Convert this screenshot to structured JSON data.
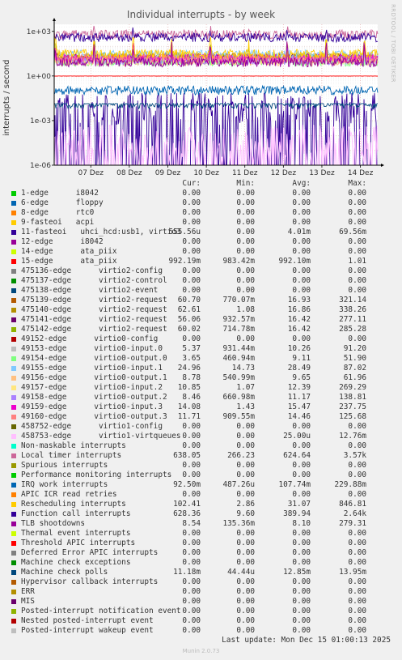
{
  "chart_data": {
    "type": "line",
    "title": "Individual interrupts - by week",
    "ylabel": "interrupts / second",
    "yscale": "log",
    "ylim": [
      1e-06,
      3000
    ],
    "yticks": [
      {
        "value": 1000,
        "label": "1e+03"
      },
      {
        "value": 1,
        "label": "1e+00"
      },
      {
        "value": 0.001,
        "label": "1e-03"
      },
      {
        "value": 1e-06,
        "label": "1e-06"
      }
    ],
    "xticks": [
      "07 Dez",
      "08 Dez",
      "09 Dez",
      "10 Dez",
      "11 Dez",
      "12 Dez",
      "13 Dez",
      "14 Dez"
    ],
    "grid": true,
    "columns": [
      "Cur:",
      "Min:",
      "Avg:",
      "Max:"
    ],
    "series": [
      {
        "name": "1-edge      i8042",
        "color": "#00cc00",
        "cur": "0.00",
        "min": "0.00",
        "avg": "0.00",
        "max": "0.00"
      },
      {
        "name": "6-edge      floppy",
        "color": "#0066b3",
        "cur": "0.00",
        "min": "0.00",
        "avg": "0.00",
        "max": "0.00"
      },
      {
        "name": "8-edge      rtc0",
        "color": "#ff8000",
        "cur": "0.00",
        "min": "0.00",
        "avg": "0.00",
        "max": "0.00"
      },
      {
        "name": "9-fasteoi   acpi",
        "color": "#ffcc00",
        "cur": "0.00",
        "min": "0.00",
        "avg": "0.00",
        "max": "0.00"
      },
      {
        "name": "11-fasteoi   uhci_hcd:usb1, virtio3",
        "color": "#330099",
        "cur": "555.56u",
        "min": "0.00",
        "avg": "4.01m",
        "max": "69.56m"
      },
      {
        "name": "12-edge      i8042",
        "color": "#990099",
        "cur": "0.00",
        "min": "0.00",
        "avg": "0.00",
        "max": "0.00"
      },
      {
        "name": "14-edge      ata_piix",
        "color": "#ccff00",
        "cur": "0.00",
        "min": "0.00",
        "avg": "0.00",
        "max": "0.00"
      },
      {
        "name": "15-edge      ata_piix",
        "color": "#ff0000",
        "cur": "992.19m",
        "min": "983.42m",
        "avg": "992.10m",
        "max": "1.01"
      },
      {
        "name": "475136-edge      virtio2-config",
        "color": "#808080",
        "cur": "0.00",
        "min": "0.00",
        "avg": "0.00",
        "max": "0.00"
      },
      {
        "name": "475137-edge      virtio2-control",
        "color": "#008f00",
        "cur": "0.00",
        "min": "0.00",
        "avg": "0.00",
        "max": "0.00"
      },
      {
        "name": "475138-edge      virtio2-event",
        "color": "#00487d",
        "cur": "0.00",
        "min": "0.00",
        "avg": "0.00",
        "max": "0.00"
      },
      {
        "name": "475139-edge      virtio2-request",
        "color": "#b35a00",
        "cur": "60.70",
        "min": "770.07m",
        "avg": "16.93",
        "max": "321.14"
      },
      {
        "name": "475140-edge      virtio2-request",
        "color": "#b38f00",
        "cur": "62.61",
        "min": "1.08",
        "avg": "16.86",
        "max": "338.26"
      },
      {
        "name": "475141-edge      virtio2-request",
        "color": "#6b006b",
        "cur": "56.06",
        "min": "932.57m",
        "avg": "16.42",
        "max": "277.11"
      },
      {
        "name": "475142-edge      virtio2-request",
        "color": "#8fb300",
        "cur": "60.02",
        "min": "714.78m",
        "avg": "16.42",
        "max": "285.28"
      },
      {
        "name": "49152-edge      virtio0-config",
        "color": "#b30000",
        "cur": "0.00",
        "min": "0.00",
        "avg": "0.00",
        "max": "0.00"
      },
      {
        "name": "49153-edge      virtio0-input.0",
        "color": "#bebebe",
        "cur": "5.37",
        "min": "931.44m",
        "avg": "10.26",
        "max": "91.20"
      },
      {
        "name": "49154-edge      virtio0-output.0",
        "color": "#80ff80",
        "cur": "3.65",
        "min": "460.94m",
        "avg": "9.11",
        "max": "51.90"
      },
      {
        "name": "49155-edge      virtio0-input.1",
        "color": "#80c9ff",
        "cur": "24.96",
        "min": "14.73",
        "avg": "28.49",
        "max": "87.02"
      },
      {
        "name": "49156-edge      virtio0-output.1",
        "color": "#ffc080",
        "cur": "8.78",
        "min": "540.99m",
        "avg": "9.65",
        "max": "61.96"
      },
      {
        "name": "49157-edge      virtio0-input.2",
        "color": "#ffe680",
        "cur": "10.85",
        "min": "1.07",
        "avg": "12.39",
        "max": "269.29"
      },
      {
        "name": "49158-edge      virtio0-output.2",
        "color": "#aa80ff",
        "cur": "8.46",
        "min": "660.98m",
        "avg": "11.17",
        "max": "138.81"
      },
      {
        "name": "49159-edge      virtio0-input.3",
        "color": "#ee00cc",
        "cur": "14.08",
        "min": "1.43",
        "avg": "15.47",
        "max": "237.75"
      },
      {
        "name": "49160-edge      virtio0-output.3",
        "color": "#ff8080",
        "cur": "11.71",
        "min": "909.55m",
        "avg": "14.46",
        "max": "125.68"
      },
      {
        "name": "458752-edge      virtio1-config",
        "color": "#666600",
        "cur": "0.00",
        "min": "0.00",
        "avg": "0.00",
        "max": "0.00"
      },
      {
        "name": "458753-edge      virtio1-virtqueues",
        "color": "#ffbfff",
        "cur": "0.00",
        "min": "0.00",
        "avg": "25.00u",
        "max": "12.76m"
      },
      {
        "name": "Non-maskable interrupts",
        "color": "#00ffcc",
        "cur": "0.00",
        "min": "0.00",
        "avg": "0.00",
        "max": "0.00"
      },
      {
        "name": "Local timer interrupts",
        "color": "#cc6699",
        "cur": "638.05",
        "min": "266.23",
        "avg": "624.64",
        "max": "3.57k"
      },
      {
        "name": "Spurious interrupts",
        "color": "#999900",
        "cur": "0.00",
        "min": "0.00",
        "avg": "0.00",
        "max": "0.00"
      },
      {
        "name": "Performance monitoring interrupts",
        "color": "#00cc00",
        "cur": "0.00",
        "min": "0.00",
        "avg": "0.00",
        "max": "0.00"
      },
      {
        "name": "IRQ work interrupts",
        "color": "#0066b3",
        "cur": "92.50m",
        "min": "487.26u",
        "avg": "107.74m",
        "max": "229.88m"
      },
      {
        "name": "APIC ICR read retries",
        "color": "#ff8000",
        "cur": "0.00",
        "min": "0.00",
        "avg": "0.00",
        "max": "0.00"
      },
      {
        "name": "Rescheduling interrupts",
        "color": "#ffcc00",
        "cur": "102.41",
        "min": "2.86",
        "avg": "31.07",
        "max": "846.81"
      },
      {
        "name": "Function call interrupts",
        "color": "#330099",
        "cur": "628.36",
        "min": "9.60",
        "avg": "389.94",
        "max": "2.64k"
      },
      {
        "name": "TLB shootdowns",
        "color": "#990099",
        "cur": "8.54",
        "min": "135.36m",
        "avg": "8.10",
        "max": "279.31"
      },
      {
        "name": "Thermal event interrupts",
        "color": "#ccff00",
        "cur": "0.00",
        "min": "0.00",
        "avg": "0.00",
        "max": "0.00"
      },
      {
        "name": "Threshold APIC interrupts",
        "color": "#ff0000",
        "cur": "0.00",
        "min": "0.00",
        "avg": "0.00",
        "max": "0.00"
      },
      {
        "name": "Deferred Error APIC interrupts",
        "color": "#808080",
        "cur": "0.00",
        "min": "0.00",
        "avg": "0.00",
        "max": "0.00"
      },
      {
        "name": "Machine check exceptions",
        "color": "#008f00",
        "cur": "0.00",
        "min": "0.00",
        "avg": "0.00",
        "max": "0.00"
      },
      {
        "name": "Machine check polls",
        "color": "#00487d",
        "cur": "11.18m",
        "min": "44.44u",
        "avg": "12.85m",
        "max": "13.95m"
      },
      {
        "name": "Hypervisor callback interrupts",
        "color": "#b35a00",
        "cur": "0.00",
        "min": "0.00",
        "avg": "0.00",
        "max": "0.00"
      },
      {
        "name": "ERR",
        "color": "#b38f00",
        "cur": "0.00",
        "min": "0.00",
        "avg": "0.00",
        "max": "0.00"
      },
      {
        "name": "MIS",
        "color": "#6b006b",
        "cur": "0.00",
        "min": "0.00",
        "avg": "0.00",
        "max": "0.00"
      },
      {
        "name": "Posted-interrupt notification event",
        "color": "#8fb300",
        "cur": "0.00",
        "min": "0.00",
        "avg": "0.00",
        "max": "0.00"
      },
      {
        "name": "Nested posted-interrupt event",
        "color": "#b30000",
        "cur": "0.00",
        "min": "0.00",
        "avg": "0.00",
        "max": "0.00"
      },
      {
        "name": "Posted-interrupt wakeup event",
        "color": "#bebebe",
        "cur": "0.00",
        "min": "0.00",
        "avg": "0.00",
        "max": "0.00"
      }
    ]
  },
  "watermark": "RRDTOOL / TOBI OETIKER",
  "footer": "Last update: Mon Dec 15 01:00:13 2025",
  "munin_version": "Munin 2.0.73"
}
